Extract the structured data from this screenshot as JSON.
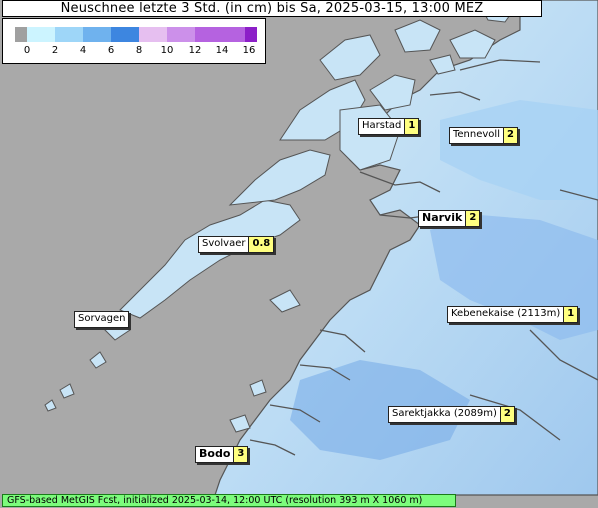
{
  "title": "Neuschnee letzte 3 Std. (in cm) bis Sa, 2025-03-15, 13:00 MEZ",
  "legend": {
    "ticks": [
      "0",
      "2",
      "4",
      "6",
      "8",
      "10",
      "12",
      "14",
      "16"
    ],
    "colors": [
      "#a0a0a0",
      "#ccf4ff",
      "#9ed6f8",
      "#6fb2ee",
      "#3d86e0",
      "#e6bff0",
      "#cc90ea",
      "#b562e0",
      "#8c1fc8"
    ]
  },
  "cities": [
    {
      "name": "Harstad",
      "value": "1"
    },
    {
      "name": "Tennevoll",
      "value": "2"
    },
    {
      "name": "Narvik",
      "value": "2"
    },
    {
      "name": "Svolvaer",
      "value": "0.8"
    },
    {
      "name": "Sorvagen",
      "value": ""
    },
    {
      "name": "Kebenekaise (2113m)",
      "value": "1"
    },
    {
      "name": "Sarektjakka (2089m)",
      "value": "2"
    },
    {
      "name": "Bodo",
      "value": "3"
    }
  ],
  "footer": "GFS-based MetGIS Fcst, initialized 2025-03-14, 12:00 UTC  (resolution 393 m X 1060 m)"
}
